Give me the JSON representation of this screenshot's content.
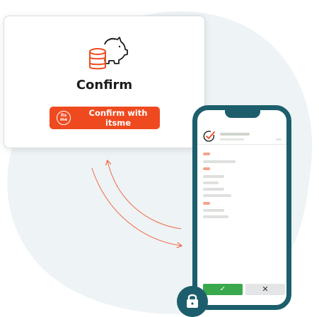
{
  "card": {
    "icon": "piggy-bank-coins-icon",
    "title": "Confirm",
    "button": {
      "label": "Confirm with itsme",
      "logo_line1": "its",
      "logo_line2": "me"
    }
  },
  "phone": {
    "header_icon": "check-circle-icon",
    "confirm_symbol": "✓",
    "cancel_symbol": "✕"
  },
  "badge": {
    "icon": "lock-icon"
  },
  "colors": {
    "brand_orange": "#ef4a1f",
    "teal": "#1c5e6c",
    "success_green": "#3aa84c",
    "placeholder_orange": "#f4a48c",
    "placeholder_grey": "#dde0dc",
    "blob": "#eef3f5"
  }
}
